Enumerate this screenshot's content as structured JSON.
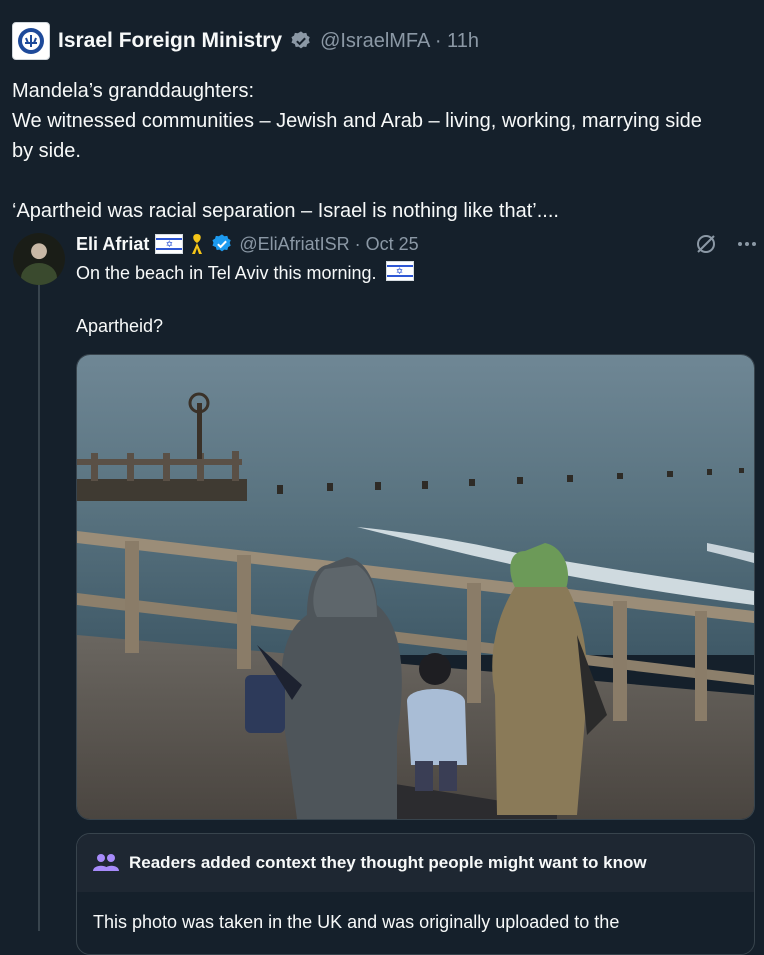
{
  "post": {
    "author_name": "Israel Foreign Ministry",
    "handle_time": "@IsraelMFA · 11h",
    "text": "Mandela’s granddaughters:\nWe witnessed communities – Jewish and Arab – living, working, marrying side by side.\n\n‘Apartheid was racial separation – Israel is nothing like that’...."
  },
  "quoted_post": {
    "author_name": "Eli Afriat",
    "handle_time": "@EliAfriatISR · Oct 25",
    "text_line1": "On the beach in Tel Aviv this morning.",
    "text_line2": "Apartheid?",
    "photo_alt": "Two women in headscarves and a child walking along a seaside promenade"
  },
  "community_note": {
    "header": "Readers added context they thought people might want to know",
    "body": "This photo was taken in the UK and was originally uploaded to the"
  },
  "colors": {
    "background": "#15202b",
    "text": "#f7f9f9",
    "muted": "#8b98a5",
    "verified_blue": "#1d9bf0",
    "note_icon": "#a78bfa"
  },
  "icons": {
    "verified_grey": "verified-badge-grey-icon",
    "verified_blue": "verified-badge-blue-icon",
    "grok": "grok-icon",
    "more": "more-icon",
    "people": "people-icon"
  }
}
